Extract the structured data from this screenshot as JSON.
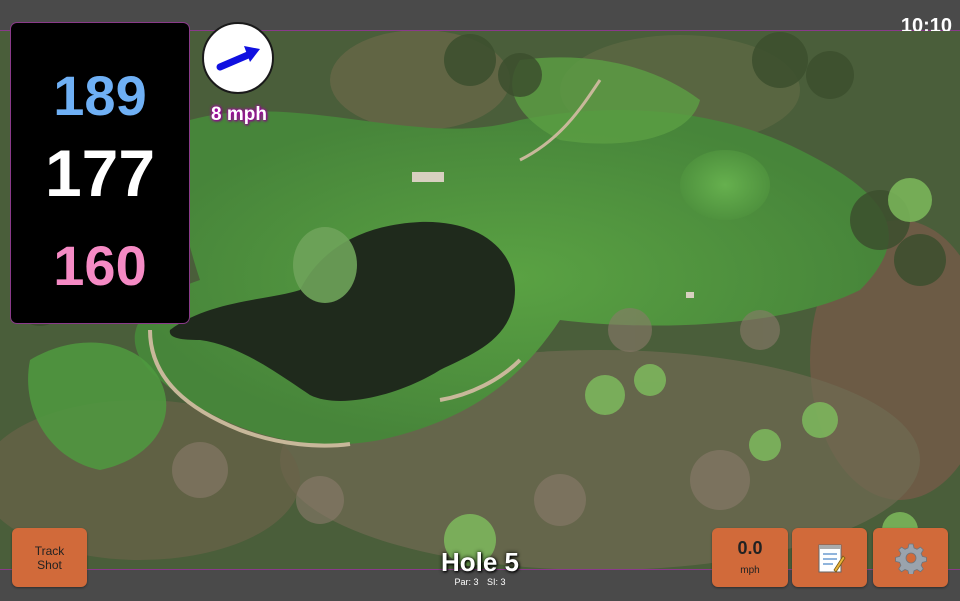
{
  "status_bar": {
    "time": "10:10"
  },
  "distances": {
    "back": "189",
    "middle": "177",
    "front": "160"
  },
  "colors": {
    "back": "#6fb0f5",
    "middle": "#ffffff",
    "front": "#f58ac4",
    "button": "#d16a3a",
    "wind_arrow": "#1010e0"
  },
  "wind": {
    "speed_label": "8 mph",
    "icon": "wind-direction-arrow-icon"
  },
  "buttons": {
    "track_shot_label": "Track Shot",
    "speed_value": "0.0",
    "speed_unit": "mph",
    "notes_icon": "notepad-icon",
    "settings_icon": "gear-icon"
  },
  "hole": {
    "title": "Hole 5",
    "par": "Par: 3",
    "si": "SI: 3"
  }
}
